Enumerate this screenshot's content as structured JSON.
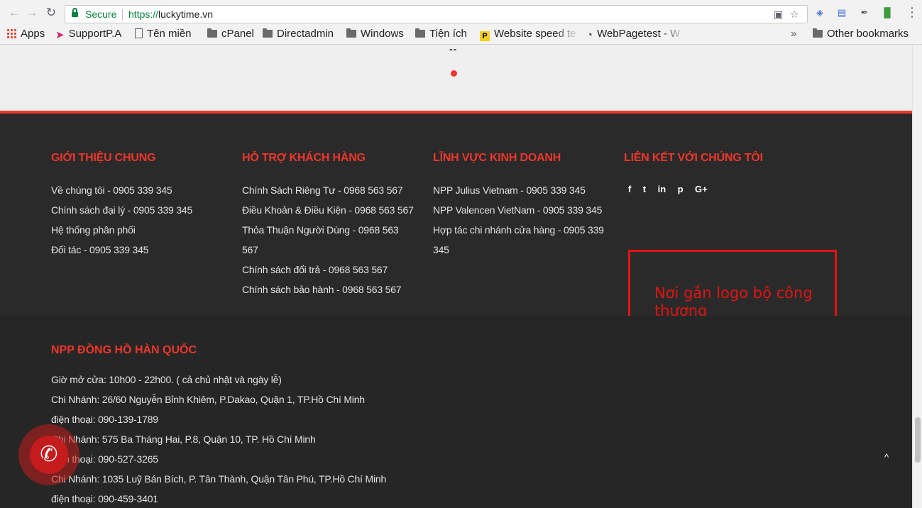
{
  "browser": {
    "secure_label": "Secure",
    "url_scheme": "https://",
    "url_host": "luckytime.vn",
    "back_icon": "arrow-left-icon",
    "forward_icon": "arrow-right-icon",
    "reload_icon": "reload-icon",
    "menu_icon": "more-vert-icon"
  },
  "bookmarks": {
    "items": [
      {
        "label": "Apps",
        "icon": "apps-grid-icon"
      },
      {
        "label": "SupportP.A",
        "icon": "support-icon"
      },
      {
        "label": "Tên miền",
        "icon": "page-icon"
      },
      {
        "label": "cPanel",
        "icon": "folder-icon"
      },
      {
        "label": "Directadmin",
        "icon": "folder-icon"
      },
      {
        "label": "Windows",
        "icon": "folder-icon"
      },
      {
        "label": "Tiện ích",
        "icon": "folder-icon"
      },
      {
        "label": "Website speed te",
        "icon": "p-icon"
      },
      {
        "label": "WebPagetest - W",
        "icon": "gauge-icon"
      }
    ],
    "overflow": "»",
    "other": "Other bookmarks"
  },
  "page": {
    "dashes": "--",
    "accent": "#f0362b"
  },
  "footer": {
    "columns": [
      {
        "title": "GIỚI THIỆU CHUNG",
        "links": [
          "Về chúng tôi - 0905 339 345",
          "Chính sách đại lý - 0905 339 345",
          "Hệ thống phân phối",
          "Đối tác - 0905 339 345"
        ]
      },
      {
        "title": "HỖ TRỢ KHÁCH HÀNG",
        "links": [
          "Chính Sách Riêng Tư - 0968 563 567",
          "Điều Khoản & Điều Kiện - 0968 563 567",
          "Thỏa Thuận Người Dùng - 0968 563 567",
          "Chính sách đổi trả - 0968 563 567",
          "Chính sách bảo hành - 0968 563 567"
        ]
      },
      {
        "title": "LĨNH VỰC KINH DOANH",
        "links": [
          "NPP Julius Vietnam - 0905 339 345",
          "NPP Valencen VietNam - 0905 339 345",
          "Hợp tác chi nhánh cửa hàng - 0905 339 345"
        ]
      },
      {
        "title": "LIÊN KẾT VỚI CHÚNG TÔI",
        "social": [
          "f",
          "t",
          "in",
          "p",
          "G+"
        ]
      }
    ],
    "logo_placeholder": "Nơi gắn logo bộ công thương",
    "store": {
      "title": "NPP ĐỒNG HỒ HÀN QUỐC",
      "lines": [
        "Giờ mở cửa: 10h00 - 22h00. ( cả chủ nhật và ngày lễ)",
        "Chi Nhánh: 26/60 Nguyễn Bỉnh Khiêm, P.Dakao, Quận 1, TP.Hồ Chí Minh",
        "điện thoại: 090-139-1789",
        "Chi Nhánh: 575 Ba Tháng Hai, P.8, Quận 10, TP. Hồ Chí Minh",
        "điện thoại: 090-527-3265",
        "Chi Nhánh: 1035 Luỹ Bán Bích, P. Tân Thành, Quận Tân Phú, TP.Hồ Chí Minh",
        "điện thoại: 090-459-3401"
      ]
    }
  },
  "widgets": {
    "call_icon": "phone-icon",
    "back_to_top_icon": "chevron-up-icon",
    "back_to_top_glyph": "^"
  }
}
